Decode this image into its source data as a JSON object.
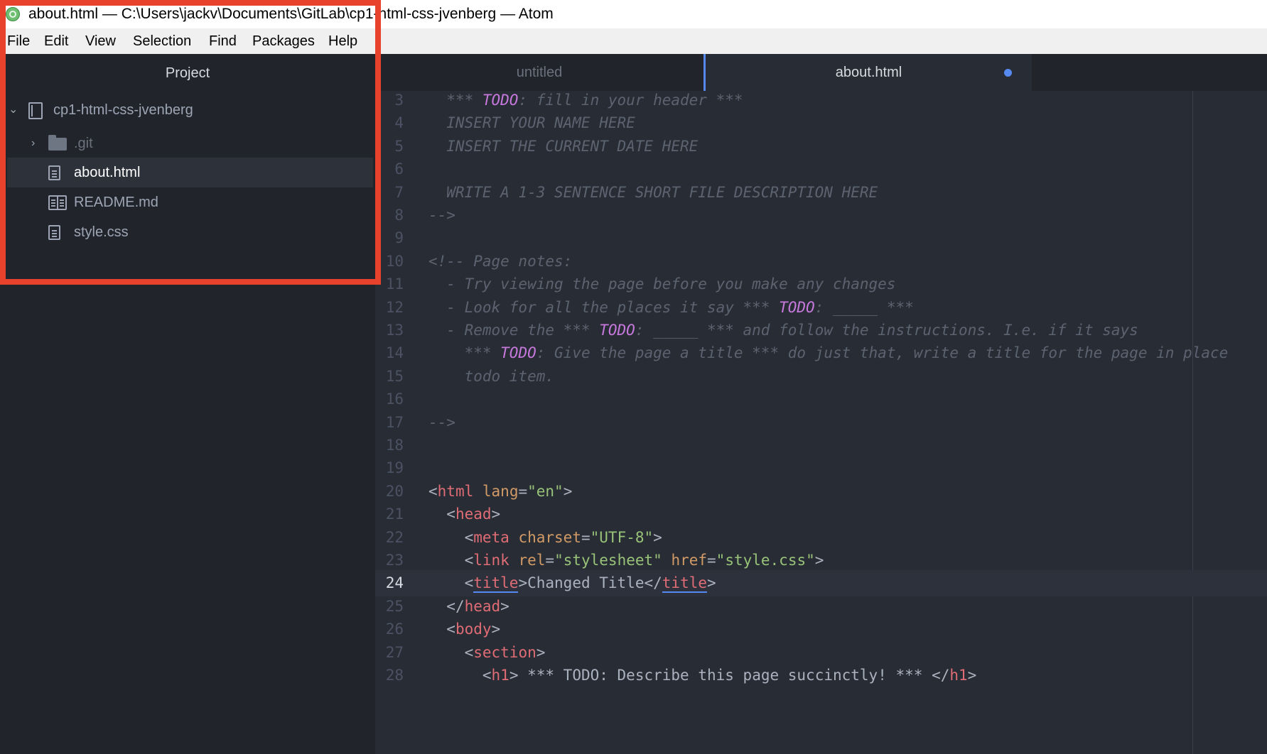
{
  "window": {
    "title": "about.html — C:\\Users\\jackv\\Documents\\GitLab\\cp1-html-css-jvenberg — Atom"
  },
  "menu": [
    "File",
    "Edit",
    "View",
    "Selection",
    "Find",
    "Packages",
    "Help"
  ],
  "tree": {
    "title": "Project",
    "root": "cp1-html-css-jvenberg",
    "items": [
      {
        "label": ".git",
        "kind": "folder"
      },
      {
        "label": "about.html",
        "kind": "file",
        "selected": true
      },
      {
        "label": "README.md",
        "kind": "markdown"
      },
      {
        "label": "style.css",
        "kind": "file"
      }
    ]
  },
  "tabs": [
    {
      "label": "untitled",
      "active": false
    },
    {
      "label": "about.html",
      "active": true,
      "modified": true
    }
  ],
  "editor": {
    "cursor_line": 24,
    "lines": [
      {
        "n": "3"
      },
      {
        "n": "4"
      },
      {
        "n": "5"
      },
      {
        "n": "6"
      },
      {
        "n": "7"
      },
      {
        "n": "8"
      },
      {
        "n": "9"
      },
      {
        "n": "10"
      },
      {
        "n": "11"
      },
      {
        "n": "12"
      },
      {
        "n": "13"
      },
      {
        "n": "14"
      },
      {
        "n": "15"
      },
      {
        "n": "16"
      },
      {
        "n": "17"
      },
      {
        "n": "18"
      },
      {
        "n": "19"
      },
      {
        "n": "20"
      },
      {
        "n": "21"
      },
      {
        "n": "22"
      },
      {
        "n": "23"
      },
      {
        "n": "24"
      },
      {
        "n": "25"
      },
      {
        "n": "26"
      },
      {
        "n": "27"
      },
      {
        "n": "28"
      }
    ],
    "code": {
      "l3": [
        "  *** ",
        "TODO",
        ": fill in your header ***"
      ],
      "l4": "  INSERT YOUR NAME HERE",
      "l5": "  INSERT THE CURRENT DATE HERE",
      "l6": "",
      "l7": "  WRITE A 1-3 SENTENCE SHORT FILE DESCRIPTION HERE",
      "l8": "-->",
      "l9": "",
      "l10": "<!-- Page notes:",
      "l11": "  - Try viewing the page before you make any changes",
      "l12": [
        "  - Look for all the places it say *** ",
        "TODO",
        ": _____ ***"
      ],
      "l13": [
        "  - Remove the *** ",
        "TODO",
        ": _____ *** and follow the instructions. I.e. if it says"
      ],
      "l14": [
        "    *** ",
        "TODO",
        ": Give the page a title *** do just that, write a title for the page in place"
      ],
      "l15": "    todo item.",
      "l16": "",
      "l17": "-->",
      "l18": "",
      "l19": "",
      "l20": {
        "tag": "html",
        "attr": "lang",
        "val": "\"en\""
      },
      "l21": {
        "tag": "head"
      },
      "l22": {
        "tag": "meta",
        "attr": "charset",
        "val": "\"UTF-8\""
      },
      "l23": {
        "tag": "link",
        "attr": "rel",
        "val": "\"stylesheet\"",
        "attr2": "href",
        "val2": "\"style.css\""
      },
      "l24": {
        "tag": "title",
        "text": "Changed Title"
      },
      "l25": {
        "tag": "head"
      },
      "l26": {
        "tag": "body"
      },
      "l27": {
        "tag": "section"
      },
      "l28": {
        "tag": "h1",
        "text": " *** TODO: Describe this page succinctly! *** "
      }
    }
  },
  "colors": {
    "accent": "#568af2",
    "highlight_box": "#e8412c",
    "todo": "#c678dd",
    "tag": "#e06c75",
    "attribute": "#d19a66",
    "string": "#98c379",
    "comment": "#5c6370"
  }
}
